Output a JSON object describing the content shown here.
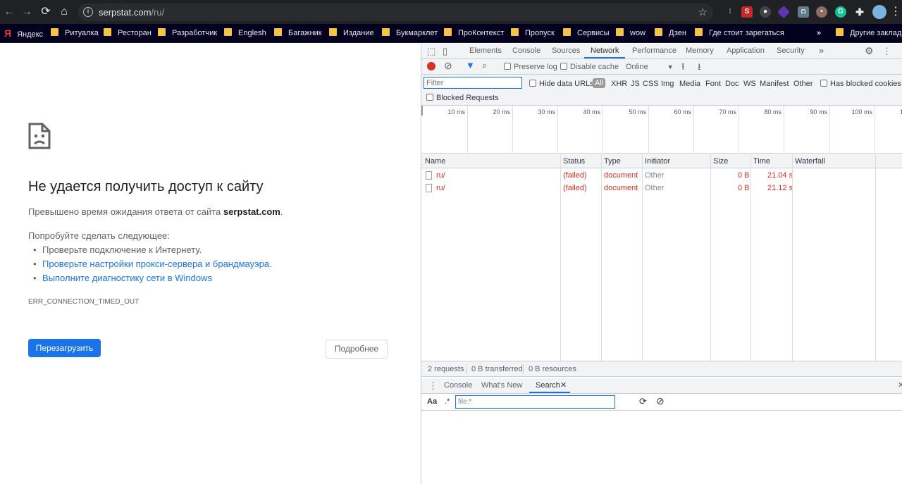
{
  "browser": {
    "url_host": "serpstat.com",
    "url_path": "/ru/",
    "bookmarks": [
      {
        "label": "Яндекс",
        "type": "yandex"
      },
      {
        "label": "Ритуалка",
        "type": "folder"
      },
      {
        "label": "Ресторан",
        "type": "folder"
      },
      {
        "label": "Разработчик",
        "type": "folder"
      },
      {
        "label": "Englesh",
        "type": "folder"
      },
      {
        "label": "Багажник",
        "type": "folder"
      },
      {
        "label": "Издание",
        "type": "folder"
      },
      {
        "label": "Букмарклет",
        "type": "folder"
      },
      {
        "label": "ПроКонтекст",
        "type": "folder"
      },
      {
        "label": "Пропуск",
        "type": "folder"
      },
      {
        "label": "Сервисы",
        "type": "folder"
      },
      {
        "label": "wow",
        "type": "folder"
      },
      {
        "label": "Дзен",
        "type": "folder"
      },
      {
        "label": "Где стоит зарегаться",
        "type": "folder"
      }
    ],
    "more_bookmarks": "»",
    "other_bookmarks": "Другие закладки"
  },
  "error_page": {
    "title": "Не удается получить доступ к сайту",
    "desc_prefix": "Превышено время ожидания ответа от сайта",
    "desc_host": "serpstat.com",
    "desc_suffix": ".",
    "try_heading": "Попробуйте сделать следующее:",
    "suggestions": [
      {
        "text": "Проверьте подключение к Интернету.",
        "link": false
      },
      {
        "text": "Проверьте настройки прокси-сервера и брандмауэра.",
        "link": true
      },
      {
        "text": "Выполните диагностику сети в Windows",
        "link": true
      }
    ],
    "error_code": "ERR_CONNECTION_TIMED_OUT",
    "reload_label": "Перезагрузить",
    "details_label": "Подробнее"
  },
  "devtools": {
    "tabs": [
      "Elements",
      "Console",
      "Sources",
      "Network",
      "Performance",
      "Memory",
      "Application",
      "Security"
    ],
    "active_tab": "Network",
    "more_tabs": "»",
    "toolbar": {
      "preserve_log": "Preserve log",
      "disable_cache": "Disable cache",
      "throttling": "Online"
    },
    "filter": {
      "placeholder": "Filter",
      "hide_data_urls": "Hide data URLs",
      "types": [
        "All",
        "XHR",
        "JS",
        "CSS",
        "Img",
        "Media",
        "Font",
        "Doc",
        "WS",
        "Manifest",
        "Other"
      ],
      "has_blocked_cookies": "Has blocked cookies",
      "blocked_requests": "Blocked Requests"
    },
    "timeline_ticks": [
      "10 ms",
      "20 ms",
      "30 ms",
      "40 ms",
      "50 ms",
      "60 ms",
      "70 ms",
      "80 ms",
      "90 ms",
      "100 ms",
      "1"
    ],
    "columns": [
      "Name",
      "Status",
      "Type",
      "Initiator",
      "Size",
      "Time",
      "Waterfall"
    ],
    "requests": [
      {
        "name": "ru/",
        "status": "(failed)",
        "type": "document",
        "initiator": "Other",
        "size": "0 B",
        "time": "21.04 s"
      },
      {
        "name": "ru/",
        "status": "(failed)",
        "type": "document",
        "initiator": "Other",
        "size": "0 B",
        "time": "21.12 s"
      }
    ],
    "summary": {
      "requests": "2 requests",
      "transferred": "0 B transferred",
      "resources": "0 B resources"
    },
    "drawer": {
      "tabs": [
        "Console",
        "What's New",
        "Search"
      ],
      "active_tab": "Search",
      "case_label": "Aa",
      "regex_label": ".*",
      "search_value": "file:*"
    }
  }
}
